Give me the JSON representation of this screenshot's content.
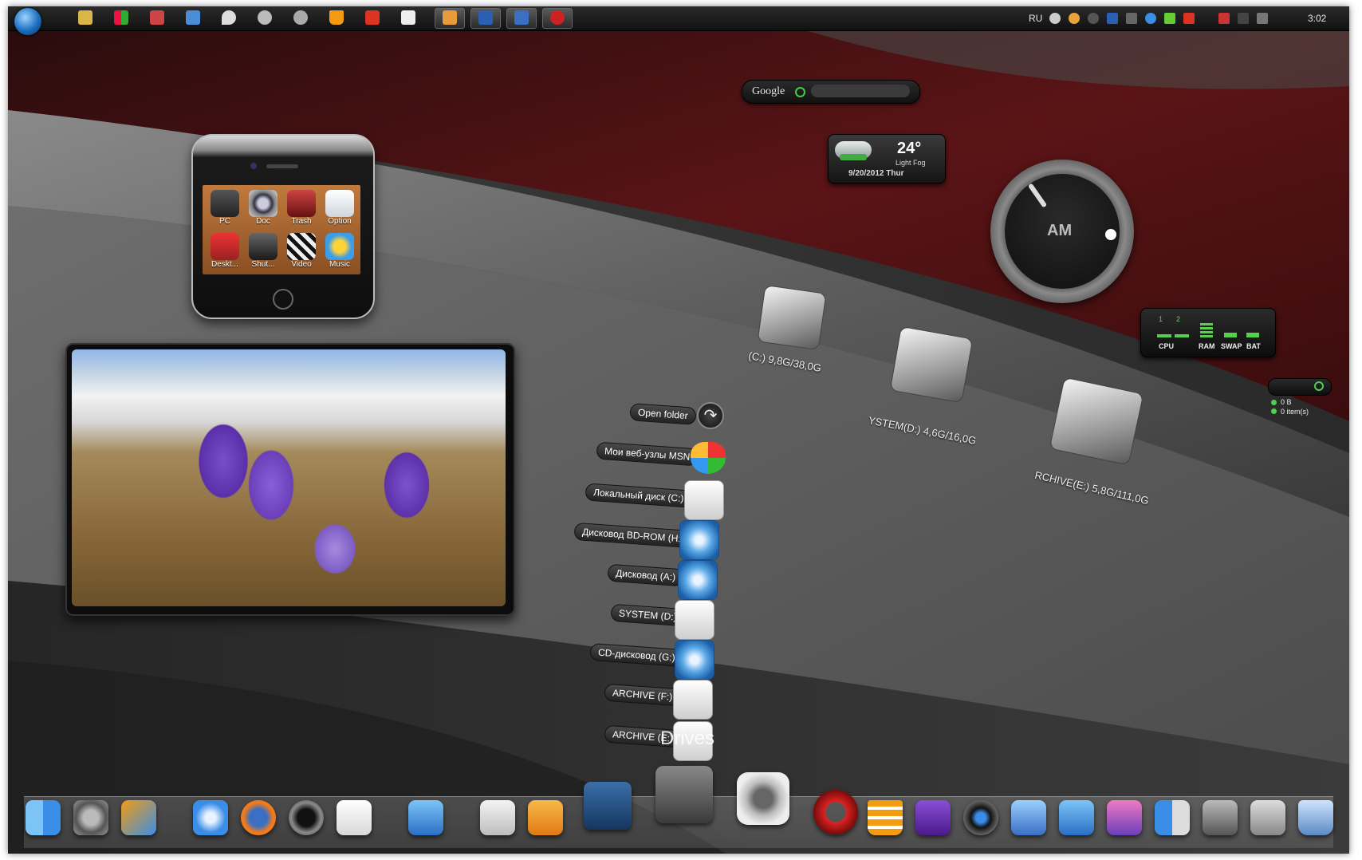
{
  "topbar": {
    "language": "RU",
    "clock": "3:02"
  },
  "google": {
    "brand": "Google",
    "placeholder": ""
  },
  "weather": {
    "temperature": "24°",
    "condition": "Light Fog",
    "date": "9/20/2012 Thur"
  },
  "clock_widget": {
    "period": "AM"
  },
  "meter_widget": {
    "labels": [
      "CPU",
      "RAM",
      "SWAP",
      "BAT"
    ],
    "core_labels": [
      "1",
      "2"
    ]
  },
  "recycle_widget": {
    "size": "0 B",
    "items": "0 item(s)"
  },
  "phone_widget": {
    "apps": [
      {
        "label": "PC"
      },
      {
        "label": "Doc"
      },
      {
        "label": "Trash"
      },
      {
        "label": "Option"
      },
      {
        "label": "Deskt..."
      },
      {
        "label": "Shut..."
      },
      {
        "label": "Video"
      },
      {
        "label": "Music"
      }
    ]
  },
  "drives_list": {
    "items": [
      {
        "label": "Open folder",
        "icon": "arrow-icon"
      },
      {
        "label": "Мои веб-узлы MSN",
        "icon": "msn-icon"
      },
      {
        "label": "Локальный диск (C:)",
        "icon": "apple-drive-icon"
      },
      {
        "label": "Дисковод BD-ROM (H:)",
        "icon": "disc-icon"
      },
      {
        "label": "Дисковод (A:)",
        "icon": "disc-icon"
      },
      {
        "label": "SYSTEM (D:)",
        "icon": "apple-drive-icon"
      },
      {
        "label": "CD-дисковод (G:)",
        "icon": "disc-icon"
      },
      {
        "label": "ARCHIVE (F:)",
        "icon": "apple-drive-icon"
      },
      {
        "label": "ARCHIVE (E:)",
        "icon": "apple-drive-icon"
      }
    ],
    "overlay_text": "Drives"
  },
  "hdd_widgets": [
    {
      "label": "(C:) 9,8G/38,0G"
    },
    {
      "label": "YSTEM(D:) 4,6G/16,0G"
    },
    {
      "label": "RCHIVE(E:) 5,8G/111,0G"
    }
  ],
  "dock": {
    "icons": [
      "finder-icon",
      "system-preferences-icon",
      "utilities-icon",
      "safari-icon",
      "firefox-icon",
      "quicktime-icon",
      "textedit-icon",
      "app-store-icon",
      "icloud-icon",
      "itunes-icon",
      "tools-icon",
      "drive-icon",
      "sync-icon",
      "opera-icon",
      "vlc-icon",
      "xfire-icon",
      "camera-icon",
      "music-note-icon",
      "app-store-icon",
      "photo-icon",
      "dashboard-icon",
      "automator-icon",
      "keychain-icon",
      "trash-icon"
    ]
  },
  "colors": {
    "accent_red": "#5a1416",
    "panel_dark": "#1e1e1e",
    "meter_green": "#55d04a"
  }
}
